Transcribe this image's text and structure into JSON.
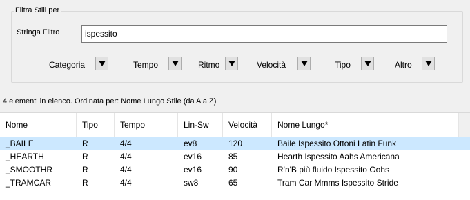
{
  "filter_group": {
    "legend": "Filtra Stili per",
    "string_label": "Stringa Filtro",
    "string_value": "ispessito",
    "categories": [
      {
        "label": "Categoria",
        "key": "categoria"
      },
      {
        "label": "Tempo",
        "key": "tempo"
      },
      {
        "label": "Ritmo",
        "key": "ritmo"
      },
      {
        "label": "Velocità",
        "key": "velocita"
      },
      {
        "label": "Tipo",
        "key": "tipo"
      },
      {
        "label": "Altro",
        "key": "altro"
      }
    ]
  },
  "list_summary": "4 elementi in elenco. Ordinata per: Nome Lungo Stile (da A a Z)",
  "table": {
    "columns": [
      "Nome",
      "Tipo",
      "Tempo",
      "Lin-Sw",
      "Velocità",
      "Nome Lungo*"
    ],
    "rows": [
      {
        "nome": "_BAILE",
        "tipo": "R",
        "tempo": "4/4",
        "linsw": "ev8",
        "velocita": "120",
        "nome_lungo": "Baile Ispessito Ottoni Latin Funk",
        "selected": true
      },
      {
        "nome": "_HEARTH",
        "tipo": "R",
        "tempo": "4/4",
        "linsw": "ev16",
        "velocita": "85",
        "nome_lungo": "Hearth Ispessito Aahs Americana",
        "selected": false
      },
      {
        "nome": "_SMOOTHR",
        "tipo": "R",
        "tempo": "4/4",
        "linsw": "ev16",
        "velocita": "90",
        "nome_lungo": "R'n'B più fluido Ispessito Oohs",
        "selected": false
      },
      {
        "nome": "_TRAMCAR",
        "tipo": "R",
        "tempo": "4/4",
        "linsw": "sw8",
        "velocita": "65",
        "nome_lungo": "Tram Car Mmms Ispessito Stride",
        "selected": false
      }
    ]
  },
  "icons": {
    "dropdown": "dropdown-arrow-icon"
  }
}
